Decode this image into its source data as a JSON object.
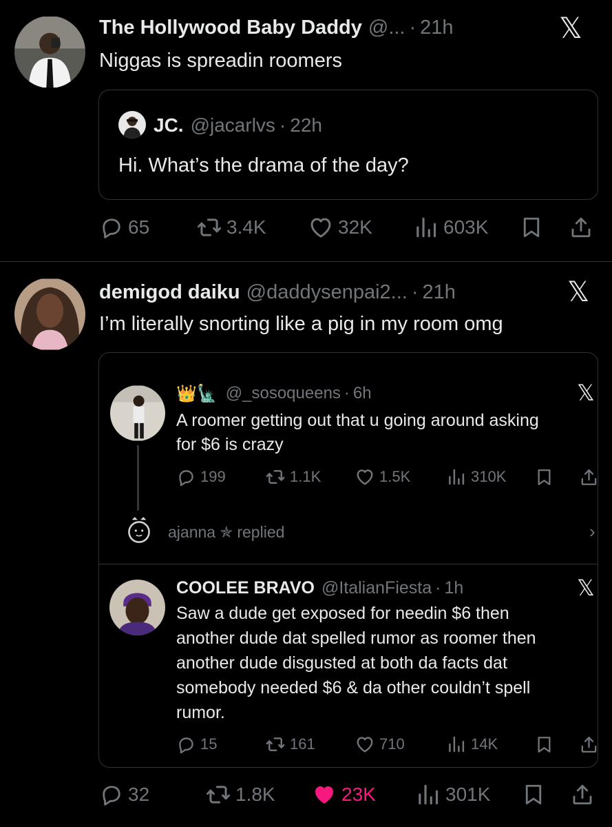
{
  "post1": {
    "author_name": "The Hollywood Baby Daddy",
    "handle": "@...",
    "dot": "·",
    "time": "21h",
    "text": "Niggas is spreadin roomers",
    "quote": {
      "author_name": "JC.",
      "handle": "@jacarlvs",
      "dot": "·",
      "time": "22h",
      "text": "Hi. What’s the drama of the day?"
    },
    "stats": {
      "replies": "65",
      "reposts": "3.4K",
      "likes": "32K",
      "views": "603K"
    }
  },
  "post2": {
    "author_name": "demigod daiku",
    "handle": "@daddysenpai2...",
    "dot": "·",
    "time": "21h",
    "text": "I’m literally snorting like a pig in my room omg",
    "embed_a": {
      "name_emoji": "👑🗽",
      "handle": "@_sosoqueens",
      "dot": "·",
      "time": "6h",
      "text_line1": "A roomer getting out that u going around asking",
      "text_line2": "for $6 is crazy",
      "stats": {
        "replies": "199",
        "reposts": "1.1K",
        "likes": "1.5K",
        "views": "310K"
      }
    },
    "reply_note": {
      "user": "ajanna",
      "star": "✯",
      "suffix": "replied"
    },
    "embed_b": {
      "author_name": "COOLEE BRAVO",
      "handle": "@ItalianFiesta",
      "dot": "·",
      "time": "1h",
      "text_lines": [
        "Saw a dude get exposed for needin $6 then",
        "another dude dat spelled rumor as roomer then",
        "another dude disgusted at both da facts dat",
        "somebody needed $6 & da other couldn’t spell",
        "rumor."
      ],
      "stats": {
        "replies": "15",
        "reposts": "161",
        "likes": "710",
        "views": "14K"
      }
    },
    "stats": {
      "replies": "32",
      "reposts": "1.8K",
      "likes": "23K",
      "views": "301K"
    }
  },
  "icons": {
    "x_logo": "𝕏",
    "reply": "reply-icon",
    "repost": "repost-icon",
    "like": "heart-icon",
    "views": "views-icon",
    "bookmark": "bookmark-icon",
    "share": "share-icon",
    "chevron": "›"
  },
  "colors": {
    "background": "#000000",
    "text": "#e7e9ea",
    "muted": "#71767b",
    "border": "#2f3336",
    "like_active": "#f91880"
  }
}
